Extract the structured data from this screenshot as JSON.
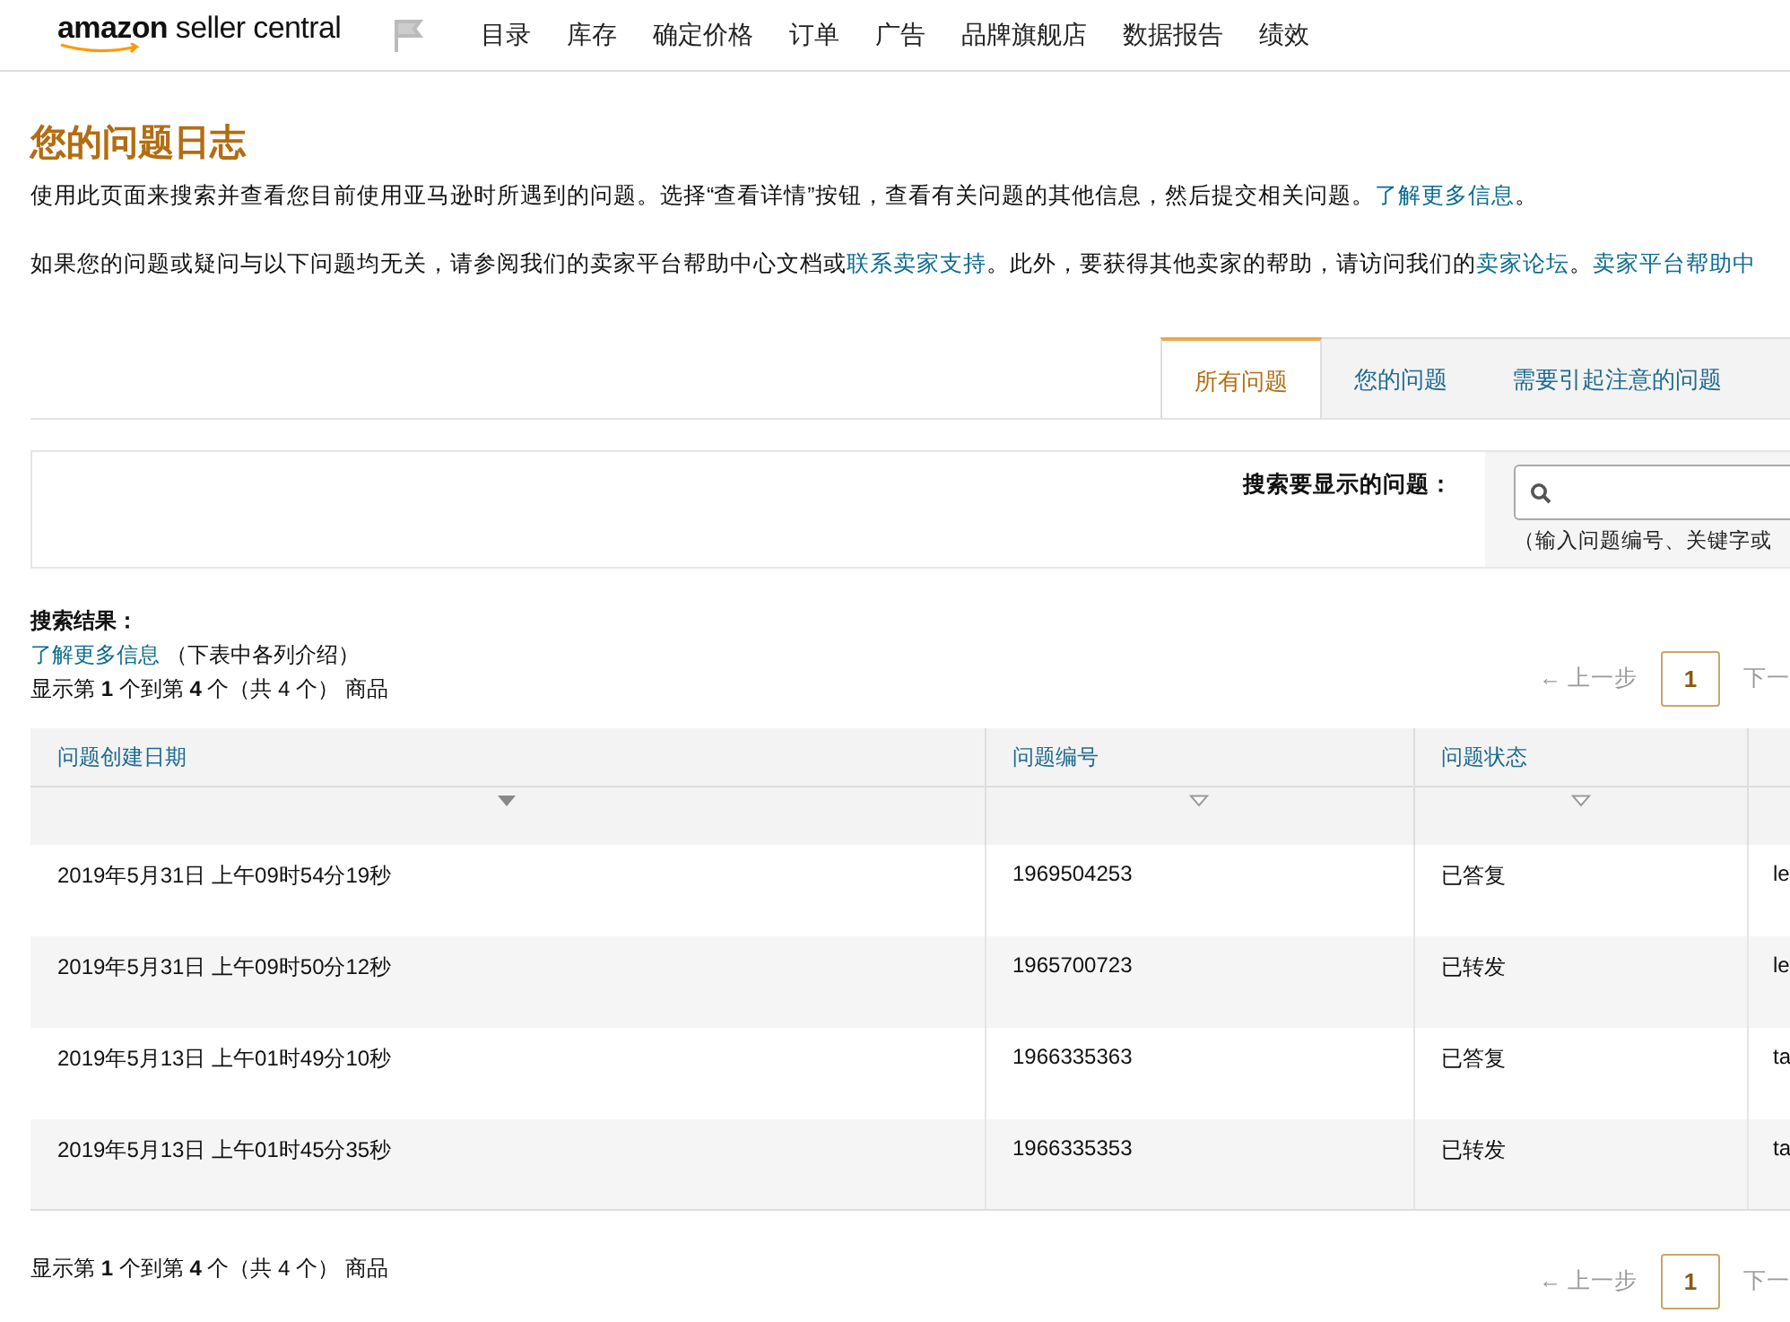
{
  "header": {
    "logo": {
      "brand": "amazon",
      "product": "seller central"
    },
    "nav": [
      "目录",
      "库存",
      "确定价格",
      "订单",
      "广告",
      "品牌旗舰店",
      "数据报告",
      "绩效"
    ]
  },
  "page_title": "您的问题日志",
  "intro": [
    [
      {
        "text": "使用此页面来搜索并查看您目前使用亚马逊时所遇到的问题。选择“查看详情”按钮，查看有关问题的其他信息，然后提交相关问题。",
        "kind": "text"
      },
      {
        "text": "了解更多信息",
        "kind": "link"
      },
      {
        "text": "。",
        "kind": "text"
      }
    ],
    [
      {
        "text": "如果您的问题或疑问与以下问题均无关，请参阅我们的卖家平台帮助中心文档或",
        "kind": "text"
      },
      {
        "text": "联系卖家支持",
        "kind": "link"
      },
      {
        "text": "。此外，要获得其他卖家的帮助，请访问我们的",
        "kind": "text"
      },
      {
        "text": "卖家论坛",
        "kind": "link"
      },
      {
        "text": "。",
        "kind": "text"
      },
      {
        "text": "卖家平台帮助中",
        "kind": "link"
      }
    ]
  ],
  "tabs": [
    {
      "label": "所有问题",
      "selected": true
    },
    {
      "label": "您的问题",
      "selected": false
    },
    {
      "label": "需要引起注意的问题",
      "selected": false
    }
  ],
  "search": {
    "label": "搜索要显示的问题：",
    "hint": "（输入问题编号、关键字或"
  },
  "results": {
    "heading": "搜索结果：",
    "link": "了解更多信息",
    "note": "（下表中各列介绍）"
  },
  "top_pagination": {
    "count": "显示第 **1** 个到第 **4** 个（共 4 个） 商品",
    "prev": {
      "arrow": "←",
      "label": "上一步",
      "disabled": true
    },
    "pages": [
      {
        "label": "1",
        "selected": true
      }
    ],
    "next": "下一"
  },
  "table": {
    "columns": [
      {
        "label": "问题创建日期",
        "sorted": true
      },
      {
        "label": "问题编号",
        "sorted": false
      },
      {
        "label": "问题状态",
        "sorted": false
      },
      {}
    ],
    "rows": [
      [
        "2019年5月31日 上午09时54分19秒",
        "1969504253",
        "已答复",
        "le"
      ],
      [
        "2019年5月31日 上午09时50分12秒",
        "1965700723",
        "已转发",
        "le"
      ],
      [
        "2019年5月13日 上午01时49分10秒",
        "1966335363",
        "已答复",
        "ta"
      ],
      [
        "2019年5月13日 上午01时45分35秒",
        "1966335353",
        "已转发",
        "ta"
      ]
    ]
  },
  "bottom_pagination": {
    "count": "显示第 **1** 个到第 **4** 个（共 4 个） 商品",
    "prev": {
      "arrow": "←",
      "label": "上一步",
      "disabled": true
    },
    "pages": [
      {
        "label": "1",
        "selected": true
      }
    ],
    "next": "下一"
  }
}
